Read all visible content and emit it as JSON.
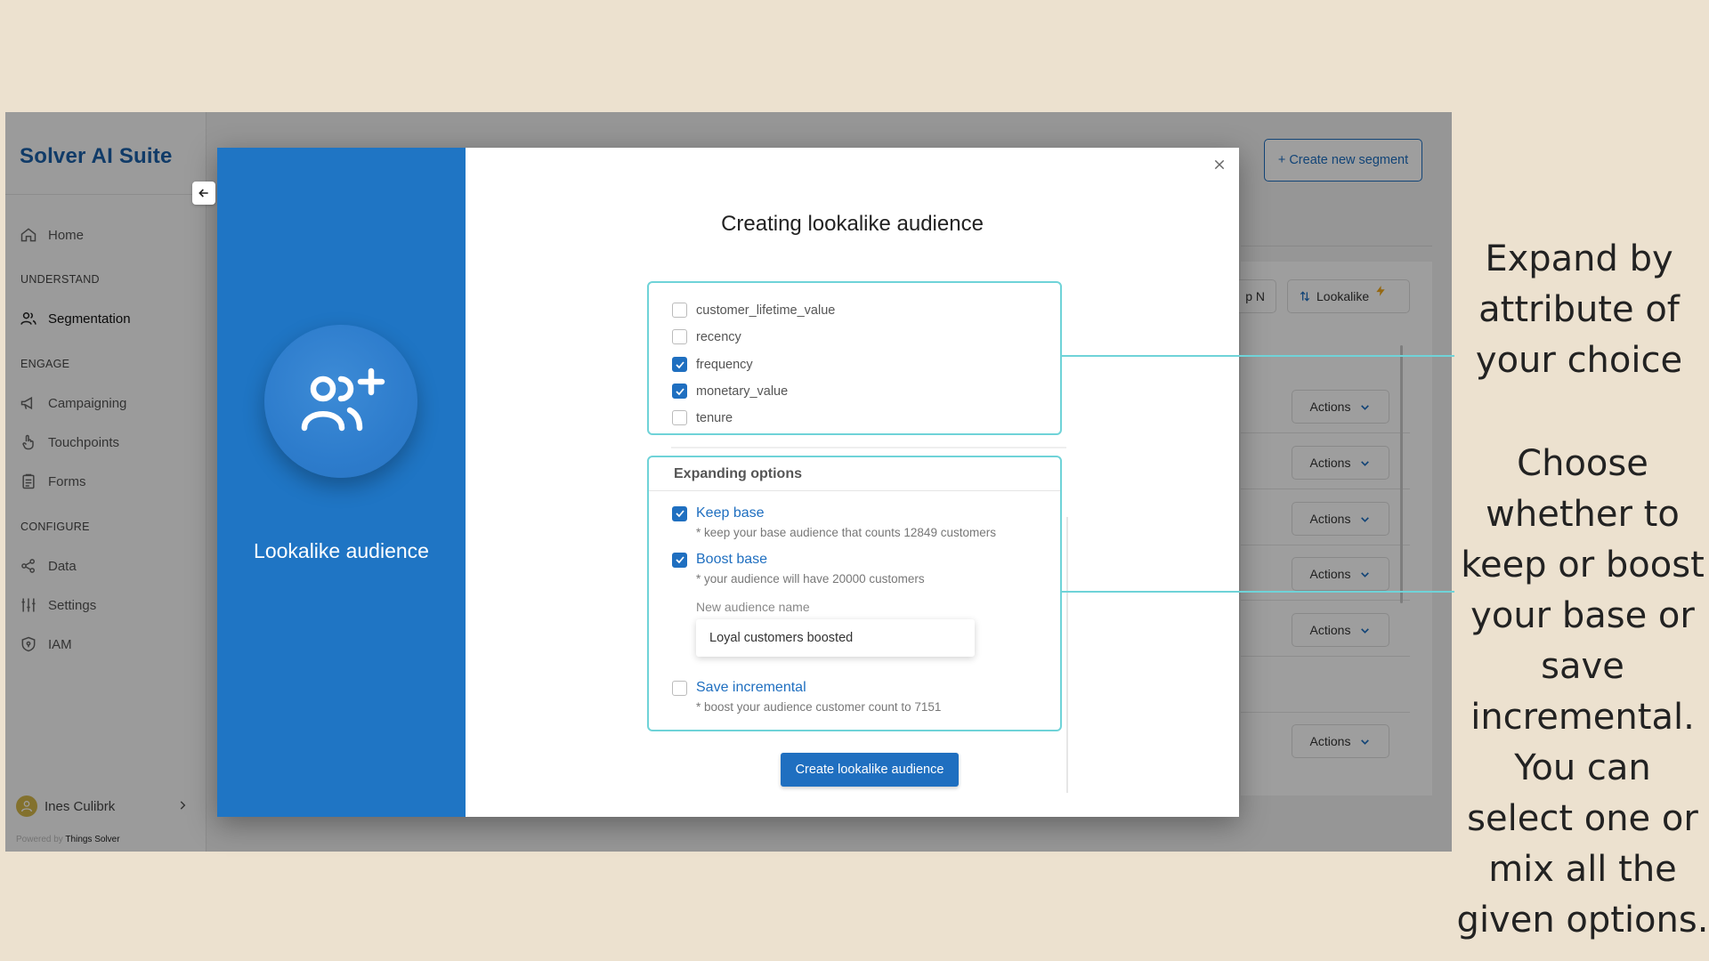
{
  "sidebar": {
    "brand": "Solver AI Suite",
    "items": {
      "home": "Home",
      "section_understand": "UNDERSTAND",
      "segmentation": "Segmentation",
      "section_engage": "ENGAGE",
      "campaigning": "Campaigning",
      "touchpoints": "Touchpoints",
      "forms": "Forms",
      "section_configure": "CONFIGURE",
      "data": "Data",
      "settings": "Settings",
      "iam": "IAM"
    },
    "user_name": "Ines Culibrk",
    "powered_prefix": "Powered by",
    "powered_brand": "Things Solver"
  },
  "main": {
    "create_segment": "+ Create new segment",
    "pill_partial": "p N",
    "lookalike_pill": "Lookalike",
    "actions_label": "Actions"
  },
  "modal": {
    "hero_label": "Lookalike audience",
    "title": "Creating lookalike audience",
    "attributes": [
      {
        "label": "customer_lifetime_value",
        "checked": false
      },
      {
        "label": "recency",
        "checked": false
      },
      {
        "label": "frequency",
        "checked": true
      },
      {
        "label": "monetary_value",
        "checked": true
      },
      {
        "label": "tenure",
        "checked": false
      }
    ],
    "options_heading": "Expanding options",
    "keep_base": {
      "title": "Keep base",
      "note": "* keep your base audience that counts 12849 customers",
      "checked": true
    },
    "boost_base": {
      "title": "Boost base",
      "note": "* your audience will have 20000 customers",
      "checked": true
    },
    "name_label": "New audience name",
    "name_value": "Loyal customers boosted",
    "save_incremental": {
      "title": "Save incremental",
      "note": "* boost your audience customer count to 7151",
      "checked": false
    },
    "create_button": "Create lookalike audience"
  },
  "callouts": {
    "top": "Expand by attribute of your choice",
    "bottom": "Choose whether to keep or boost your base or save incremental. You can select one or mix all the given options."
  },
  "colors": {
    "background": "#ece1cf",
    "accent": "#1f75c4",
    "highlight": "#6fd3d8"
  }
}
